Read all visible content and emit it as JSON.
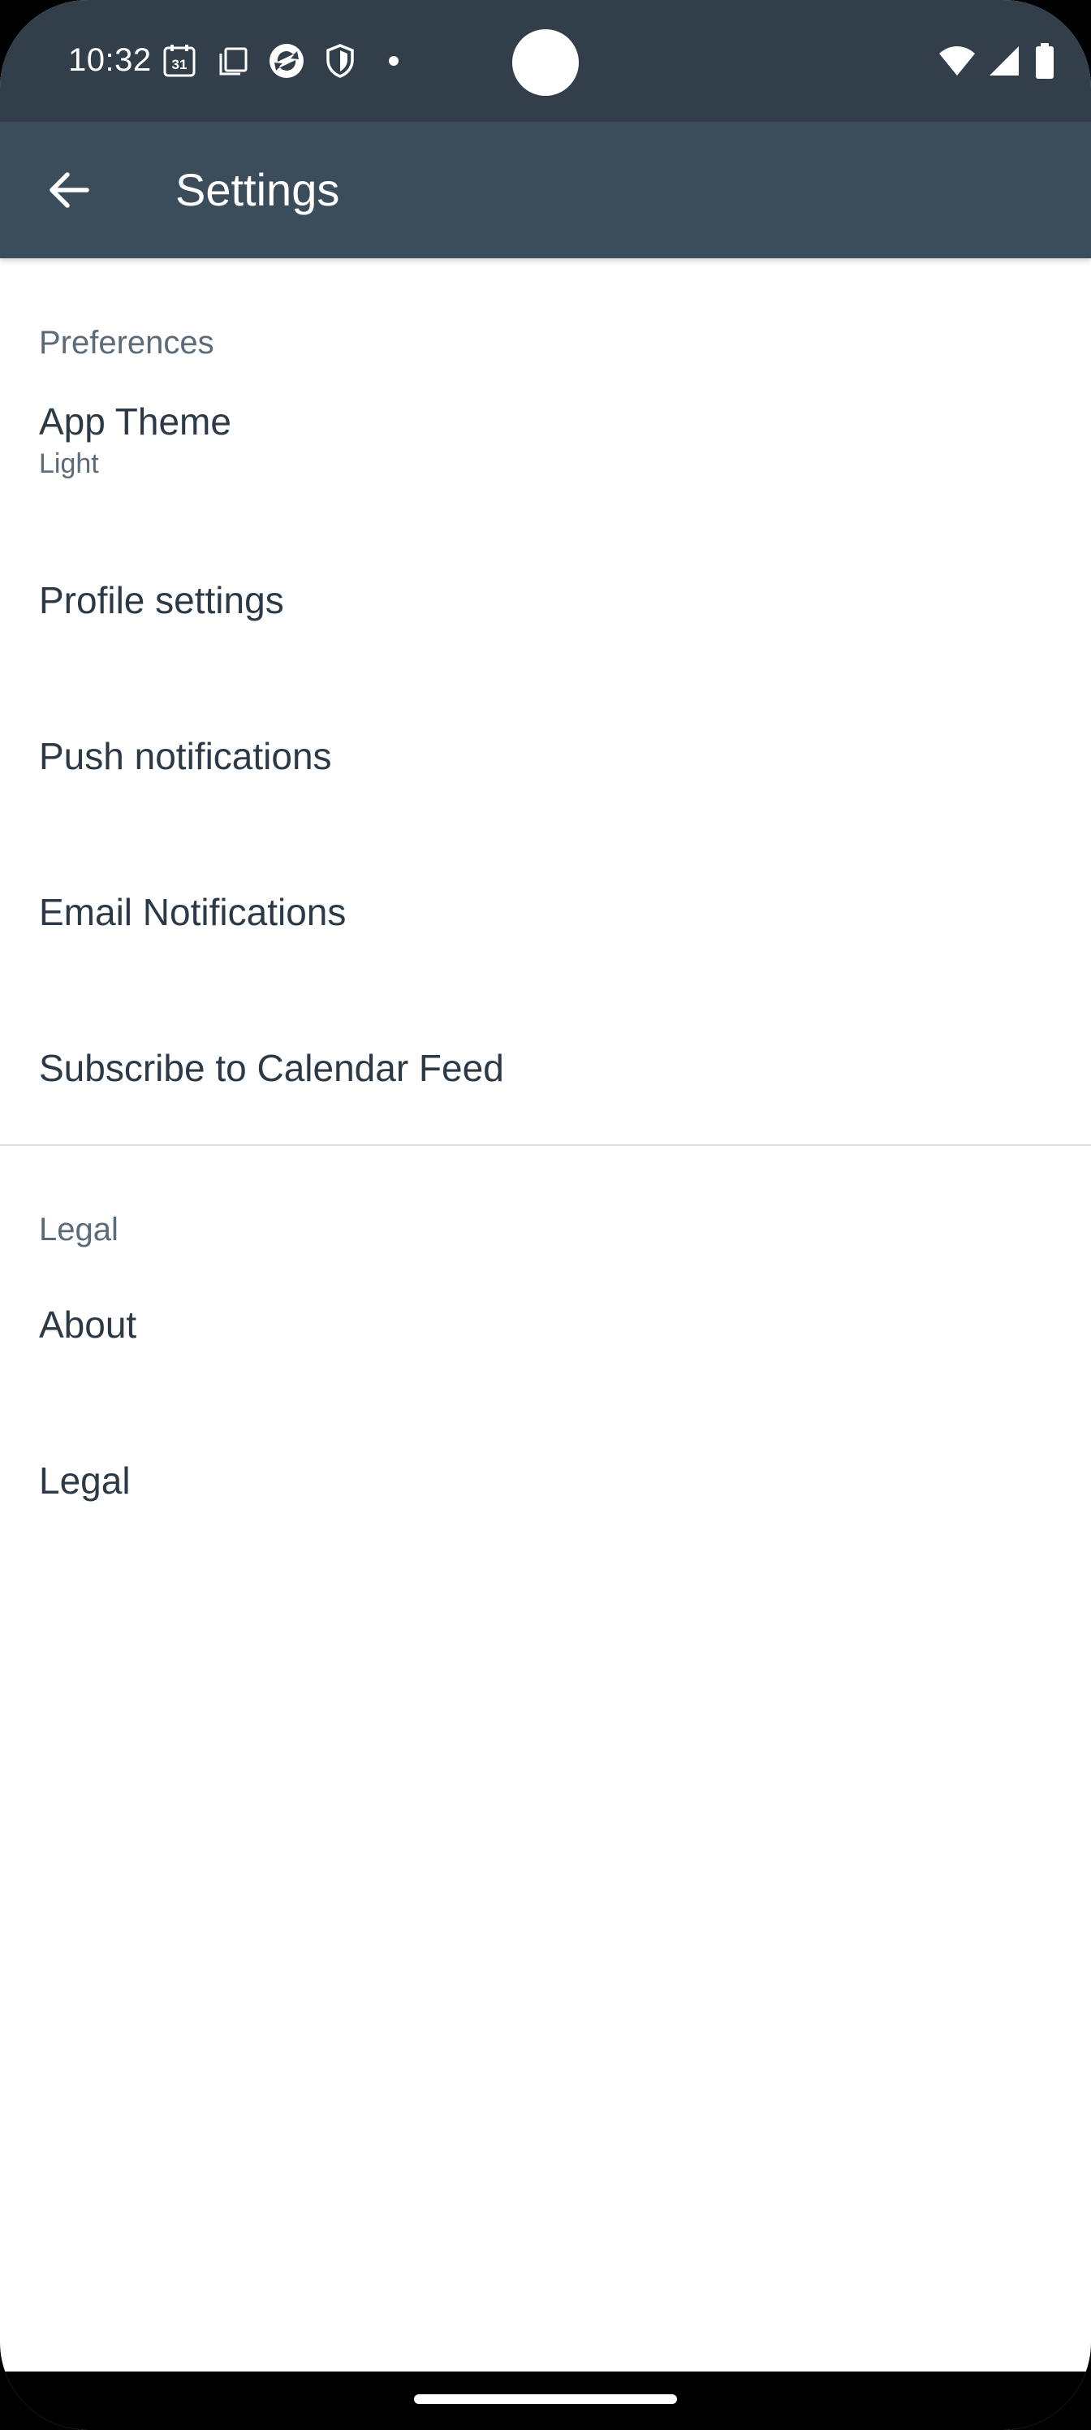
{
  "status_bar": {
    "time": "10:32",
    "calendar_day": "31",
    "left_icons": [
      "calendar-icon",
      "copy-icon",
      "sync-app-icon",
      "shield-icon",
      "dot-icon"
    ],
    "right_icons": [
      "wifi-icon",
      "cell-signal-icon",
      "battery-icon"
    ]
  },
  "app_bar": {
    "title": "Settings"
  },
  "sections": {
    "preferences": {
      "header": "Preferences",
      "items": [
        {
          "title": "App Theme",
          "subtitle": "Light"
        },
        {
          "title": "Profile settings"
        },
        {
          "title": "Push notifications"
        },
        {
          "title": "Email Notifications"
        },
        {
          "title": "Subscribe to Calendar Feed"
        }
      ]
    },
    "legal": {
      "header": "Legal",
      "items": [
        {
          "title": "About"
        },
        {
          "title": "Legal"
        }
      ]
    }
  },
  "colors": {
    "status_bar": "#323f4a",
    "app_bar": "#3b4d5b",
    "text_primary": "#2b3a46",
    "text_secondary": "#5b6b79",
    "divider": "#d9dde0"
  }
}
